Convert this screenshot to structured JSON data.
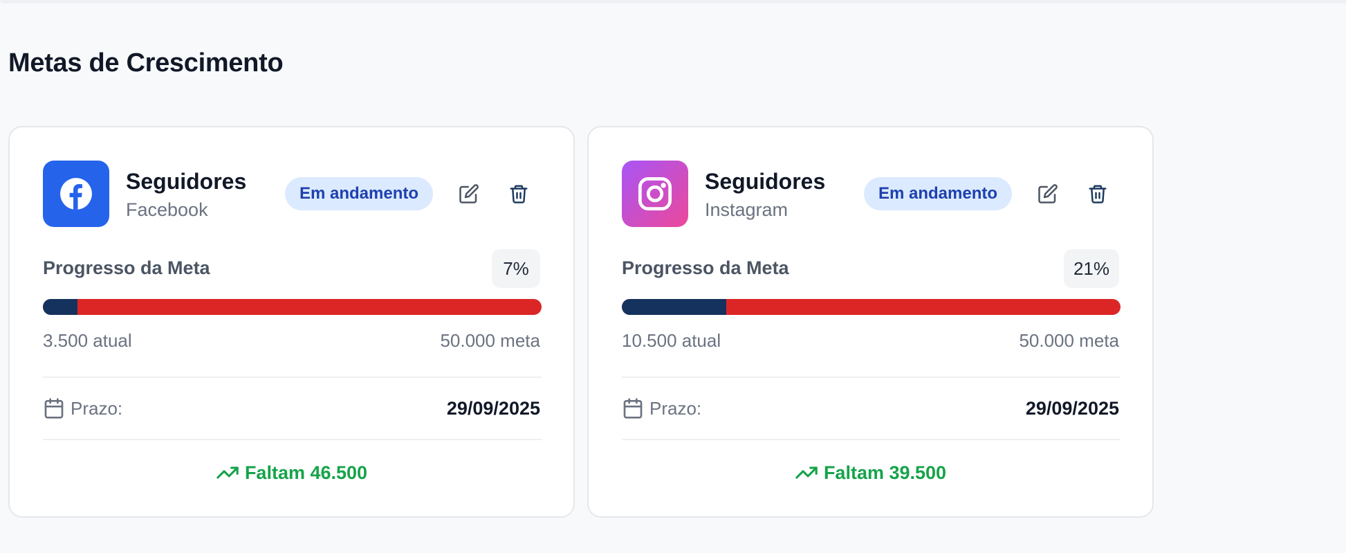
{
  "section": {
    "title": "Metas de Crescimento"
  },
  "colors": {
    "progress_filled": "#15325f",
    "progress_remaining": "#dc2626",
    "badge_bg": "#dbeafe",
    "badge_text": "#1e40af",
    "remaining_text": "#16a34a",
    "facebook": "#2563eb",
    "instagram_from": "#a855f7",
    "instagram_to": "#ec4899"
  },
  "cards": [
    {
      "icon": "facebook-icon",
      "metric": "Seguidores",
      "platform": "Facebook",
      "status": "Em andamento",
      "progress_label": "Progresso da Meta",
      "percent": "7%",
      "progress_fraction": 0.07,
      "current": "3.500 atual",
      "target": "50.000 meta",
      "deadline_label": "Prazo:",
      "deadline": "29/09/2025",
      "remaining": "Faltam 46.500"
    },
    {
      "icon": "instagram-icon",
      "metric": "Seguidores",
      "platform": "Instagram",
      "status": "Em andamento",
      "progress_label": "Progresso da Meta",
      "percent": "21%",
      "progress_fraction": 0.21,
      "current": "10.500 atual",
      "target": "50.000 meta",
      "deadline_label": "Prazo:",
      "deadline": "29/09/2025",
      "remaining": "Faltam 39.500"
    }
  ]
}
